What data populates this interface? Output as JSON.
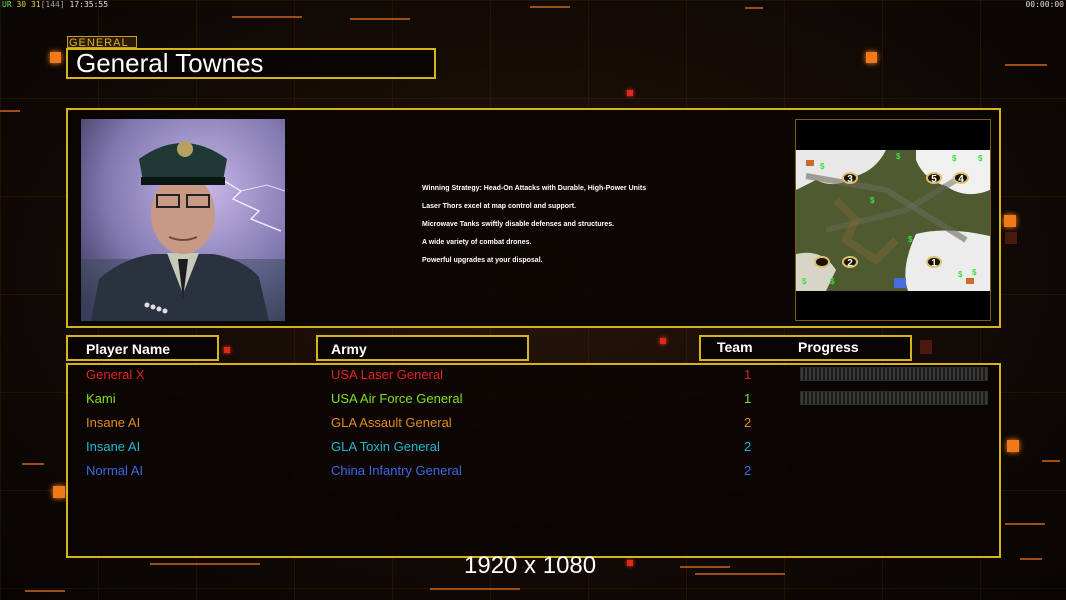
{
  "status_bar": {
    "left_prefix": "UR",
    "fps_a": "30",
    "fps_b": "31",
    "fps_c": "[144]",
    "clock": "17:35:55",
    "timer": "00:00:00"
  },
  "general": {
    "tag": "GENERAL",
    "name": "General Townes"
  },
  "strategy": {
    "lines": [
      "Winning Strategy: Head-On Attacks with Durable, High-Power Units",
      "Laser Thors excel at map control and support.",
      "Microwave Tanks swiftly disable defenses and structures.",
      "A wide variety of combat drones.",
      "Powerful upgrades at your disposal."
    ]
  },
  "minimap": {
    "waypoints": [
      "3",
      "5",
      "4",
      "2",
      "1",
      ""
    ],
    "dollar_symbol": "$"
  },
  "table": {
    "headers": {
      "player": "Player Name",
      "army": "Army",
      "team": "Team",
      "progress": "Progress"
    },
    "rows": [
      {
        "name": "General X",
        "army": "USA Laser General",
        "team": "1",
        "color": "#e02020",
        "progress_bar": true
      },
      {
        "name": "Kami",
        "army": "USA Air Force General",
        "team": "1",
        "color": "#80e020",
        "progress_bar": true
      },
      {
        "name": "Insane AI",
        "army": "GLA Assault General",
        "team": "2",
        "color": "#e08a20",
        "progress_bar": false
      },
      {
        "name": "Insane AI",
        "army": "GLA Toxin General",
        "team": "2",
        "color": "#20b8d8",
        "progress_bar": false
      },
      {
        "name": "Normal AI",
        "army": "China Infantry General",
        "team": "2",
        "color": "#3a6ae0",
        "progress_bar": false
      }
    ]
  },
  "resolution_label": "1920 x 1080",
  "colors": {
    "frame": "#d4b418",
    "accent": "#f07a18"
  }
}
